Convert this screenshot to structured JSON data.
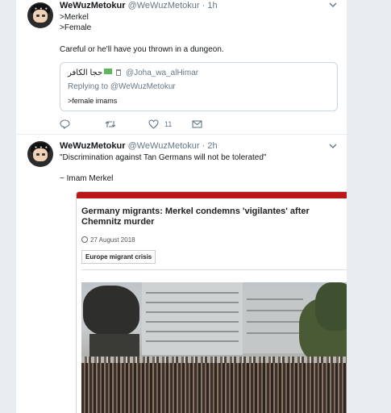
{
  "tweets": [
    {
      "name": "WeWuzMetokur",
      "handle": "@WeWuzMetokur",
      "separator": "·",
      "time": "1h",
      "lines": [
        ">Merkel",
        ">Female",
        "",
        "Careful or he'll have you thrown in a dungeon."
      ],
      "quote": {
        "name": "حجا الكافر",
        "handle": "@Joha_wa_alHimar",
        "replying_prefix": "Replying to",
        "replying_to": "@WeWuzMetokur",
        "text": ">female imams"
      },
      "actions": {
        "reply_icon": "reply-icon",
        "retweet_icon": "retweet-icon",
        "like_icon": "heart-icon",
        "like_count": "11",
        "dm_icon": "message-icon"
      }
    },
    {
      "name": "WeWuzMetokur",
      "handle": "@WeWuzMetokur",
      "separator": "·",
      "time": "2h",
      "lines": [
        "\"Discrimination against Tan Germans will not be tolerated\"",
        "",
        "~ Imam Merkel"
      ],
      "card": {
        "title": "Germany migrants: Merkel condemns 'vigilantes' after Chemnitz murder",
        "date": "27 August 2018",
        "tag": "Europe migrant crisis"
      }
    }
  ],
  "colors": {
    "background": "#e6ecf0",
    "text": "#14171a",
    "muted": "#657786",
    "bbc_red": "#bb1919"
  }
}
